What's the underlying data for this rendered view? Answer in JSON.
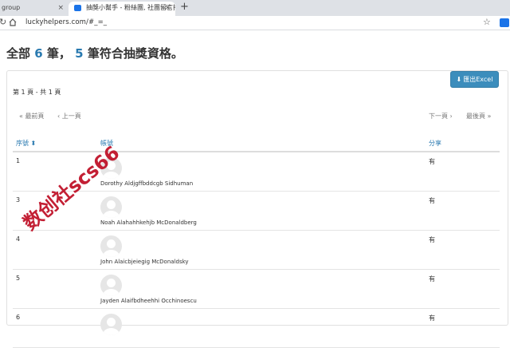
{
  "browser": {
    "tab_inactive_title": "group",
    "tab_active_title": "抽獎小幫手 - 粉絲團, 社團留言抽",
    "url": "luckyhelpers.com/#_=_"
  },
  "summary": {
    "prefix": "全部",
    "total": "6",
    "middle": "筆，",
    "eligible": "5",
    "suffix": "筆符合抽獎資格。"
  },
  "export_button": "匯出Excel",
  "page_info": "第 1 頁 - 共 1 頁",
  "pager": {
    "first": "« 最前頁",
    "prev": "‹ 上一頁",
    "next": "下一頁 ›",
    "last": "最後頁 »"
  },
  "table": {
    "headers": {
      "seq": "序號",
      "account": "帳號",
      "share": "分享"
    },
    "rows": [
      {
        "seq": "1",
        "name": "Dorothy Aldjgffbddcgb Sidhuman",
        "share": "有"
      },
      {
        "seq": "3",
        "name": "Noah Alahahhkehjb McDonaldberg",
        "share": "有"
      },
      {
        "seq": "4",
        "name": "John Alaicbjeiegig McDonaldsky",
        "share": "有"
      },
      {
        "seq": "5",
        "name": "Jayden Alaifbdheehhi Occhinoescu",
        "share": "有"
      },
      {
        "seq": "6",
        "name": "",
        "share": "有"
      }
    ]
  },
  "watermark": "数创社scs66"
}
